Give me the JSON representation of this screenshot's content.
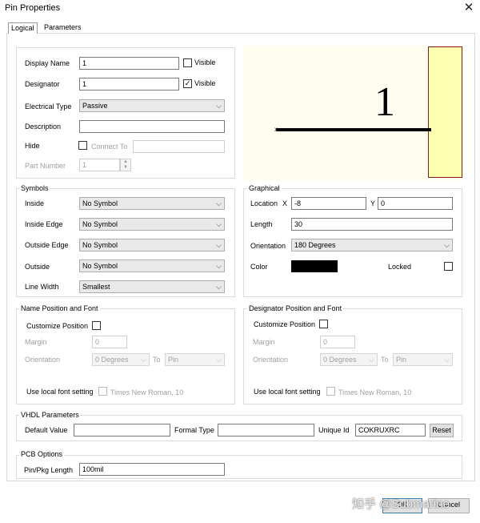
{
  "window": {
    "title": "Pin Properties",
    "close_glyph": "✕"
  },
  "tabs": [
    "Logical",
    "Parameters"
  ],
  "properties": {
    "display_name_label": "Display Name",
    "display_name_value": "1",
    "visible_label": "Visible",
    "display_name_visible": false,
    "designator_label": "Designator",
    "designator_value": "1",
    "designator_visible": true,
    "electrical_type_label": "Electrical Type",
    "electrical_type_value": "Passive",
    "description_label": "Description",
    "description_value": "",
    "hide_label": "Hide",
    "connect_to_label": "Connect To",
    "connect_to_value": "",
    "part_number_label": "Part Number",
    "part_number_value": "1"
  },
  "preview": {
    "pin_number": "1"
  },
  "symbols": {
    "title": "Symbols",
    "inside_label": "Inside",
    "inside_value": "No Symbol",
    "inside_edge_label": "Inside Edge",
    "inside_edge_value": "No Symbol",
    "outside_edge_label": "Outside Edge",
    "outside_edge_value": "No Symbol",
    "outside_label": "Outside",
    "outside_value": "No Symbol",
    "line_width_label": "Line Width",
    "line_width_value": "Smallest"
  },
  "graphical": {
    "title": "Graphical",
    "location_label": "Location",
    "x_label": "X",
    "x_value": "-8",
    "y_label": "Y",
    "y_value": "0",
    "length_label": "Length",
    "length_value": "30",
    "orientation_label": "Orientation",
    "orientation_value": "180 Degrees",
    "color_label": "Color",
    "color_value": "#000000",
    "locked_label": "Locked"
  },
  "name_font": {
    "title": "Name Position and Font",
    "customize_label": "Customize Position",
    "margin_label": "Margin",
    "margin_value": "0",
    "orientation_label": "Orientation",
    "orientation_value": "0 Degrees",
    "to_label": "To",
    "to_value": "Pin",
    "local_font_label": "Use local font setting",
    "font_value": "Times New Roman, 10"
  },
  "designator_font": {
    "title": "Designator Position and Font",
    "customize_label": "Customize Position",
    "margin_label": "Margin",
    "margin_value": "0",
    "orientation_label": "Orientation",
    "orientation_value": "0 Degrees",
    "to_label": "To",
    "to_value": "Pin",
    "local_font_label": "Use local font setting",
    "font_value": "Times New Roman, 10"
  },
  "vhdl": {
    "title": "VHDL Parameters",
    "default_value_label": "Default Value",
    "default_value": "",
    "formal_type_label": "Formal Type",
    "formal_type": "",
    "unique_id_label": "Unique Id",
    "unique_id": "COKRUXRC",
    "reset_label": "Reset"
  },
  "pcb": {
    "title": "PCB Options",
    "pkg_length_label": "Pin/Pkg Length",
    "pkg_length_value": "100mil"
  },
  "footer": {
    "ok_label": "OK",
    "cancel_label": "Cancel"
  },
  "watermark": "知乎 @Submarine"
}
